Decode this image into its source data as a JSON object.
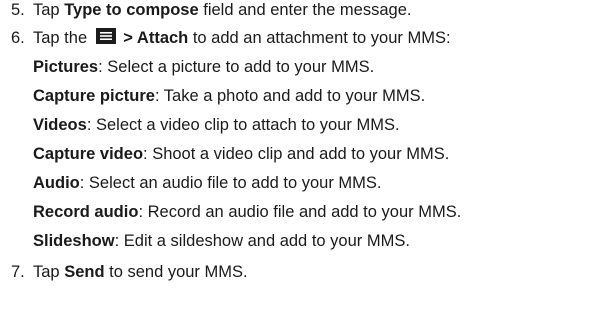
{
  "steps": [
    {
      "number": "5.",
      "parts": {
        "t1": "Tap ",
        "b1": "Type to compose",
        "t2": " field and enter the message."
      }
    },
    {
      "number": "6.",
      "parts": {
        "t1": "Tap the ",
        "icon": "menu-icon",
        "b1": " > Attach",
        "t2": " to add an attachment to your MMS:"
      },
      "options": [
        {
          "label": "Pictures",
          "desc": ": Select a picture to add to your MMS."
        },
        {
          "label": "Capture picture",
          "desc": ": Take a photo and add to your MMS."
        },
        {
          "label": "Videos",
          "desc": ": Select a video clip to attach to your MMS."
        },
        {
          "label": "Capture video",
          "desc": ": Shoot a video clip and add to your MMS."
        },
        {
          "label": "Audio",
          "desc": ": Select an audio file to add to your MMS."
        },
        {
          "label": "Record audio",
          "desc": ": Record an audio file and add to your MMS."
        },
        {
          "label": "Slideshow",
          "desc": ": Edit a sildeshow and add to your MMS."
        }
      ]
    },
    {
      "number": "7.",
      "parts": {
        "t1": "Tap ",
        "b1": "Send",
        "t2": " to send your MMS."
      }
    }
  ],
  "colors": {
    "text": "#1a1a1a",
    "icon_dark": "#1c1c1c",
    "icon_light": "#ffffff"
  }
}
